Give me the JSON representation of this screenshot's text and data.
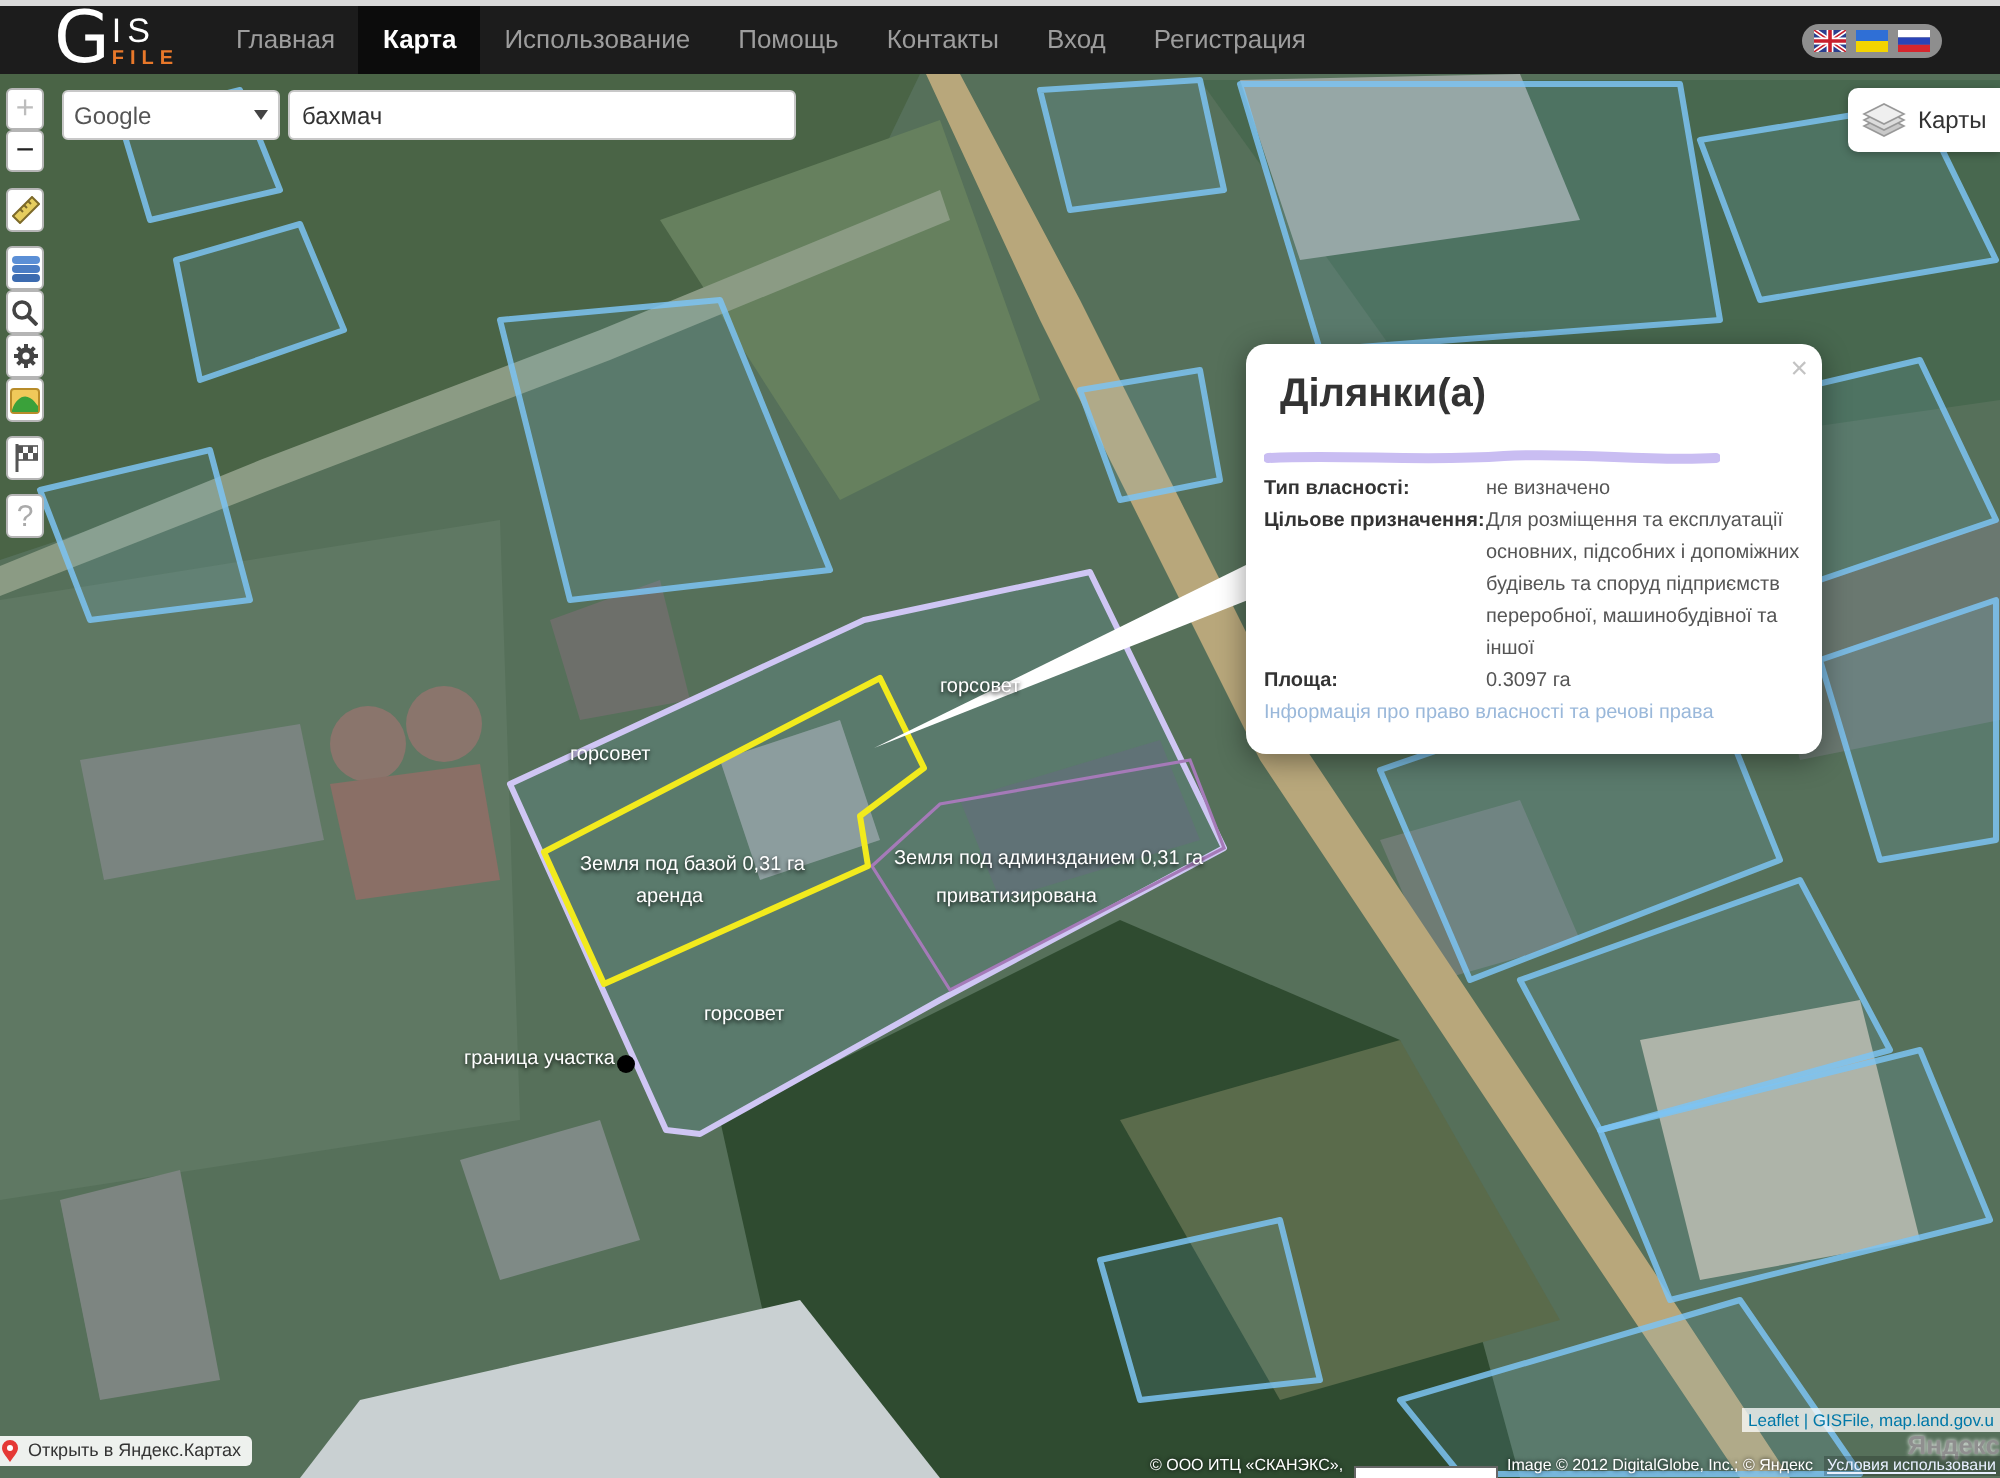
{
  "header": {
    "logo": {
      "initial": "G",
      "rest": "IS",
      "subtitle": "FILE"
    },
    "nav": [
      {
        "label": "Главная",
        "selected": false
      },
      {
        "label": "Карта",
        "selected": true
      },
      {
        "label": "Использование",
        "selected": false
      },
      {
        "label": "Помощь",
        "selected": false
      },
      {
        "label": "Контакты",
        "selected": false
      },
      {
        "label": "Вход",
        "selected": false
      },
      {
        "label": "Регистрация",
        "selected": false
      }
    ],
    "languages": [
      {
        "kind": "english"
      },
      {
        "kind": "ukrainian"
      },
      {
        "kind": "russian"
      }
    ]
  },
  "zoom": [
    {
      "label": "+",
      "disabled": true
    },
    {
      "label": "−",
      "disabled": false
    }
  ],
  "search": {
    "provider": "Google",
    "query": "бахмач"
  },
  "tool_groups": [
    [
      {
        "kind": "ruler"
      }
    ],
    [
      {
        "kind": "layers"
      },
      {
        "kind": "search"
      },
      {
        "kind": "gear"
      },
      {
        "kind": "image"
      }
    ],
    [
      {
        "kind": "flag"
      }
    ],
    [
      {
        "kind": "help",
        "glyph": "?"
      }
    ]
  ],
  "layers_button": {
    "label": "Карты"
  },
  "map_annotations": [
    {
      "text": "горсовет"
    },
    {
      "text": "горсовет"
    },
    {
      "text": "Земля под базой 0,31 га"
    },
    {
      "text": "аренда"
    },
    {
      "text": "Земля под админзданием 0,31 га"
    },
    {
      "text": "приватизирована"
    },
    {
      "text": "горсовет"
    },
    {
      "text": "граница участка"
    }
  ],
  "popup": {
    "title": "Ділянки(а)",
    "close": "×",
    "rows": [
      {
        "kind": "redacted"
      },
      {
        "kind": "field",
        "label": "Тип власності:",
        "value": "не визначено"
      },
      {
        "kind": "field",
        "label": "Цільове призначення:",
        "value": "Для розміщення та експлуатації основних, підсобних і допоміжних будівель та споруд підприємств переробної, машинобудівної та іншої"
      },
      {
        "kind": "field",
        "label": "Площа:",
        "value": "0.3097 га"
      }
    ],
    "link": "Інформація про право власності та речові права"
  },
  "footer": {
    "open_in_maps": "Открыть в Яндекс.Картах",
    "attribution": "Leaflet | GISFile, map.land.gov.u",
    "map_logo": "Яндекс",
    "copyright": [
      "© ООО ИТЦ «СКАНЭКС»,",
      "Image © 2012 DigitalGlobe, Inc.; © Яндекс"
    ],
    "terms": "Условия использовани"
  }
}
